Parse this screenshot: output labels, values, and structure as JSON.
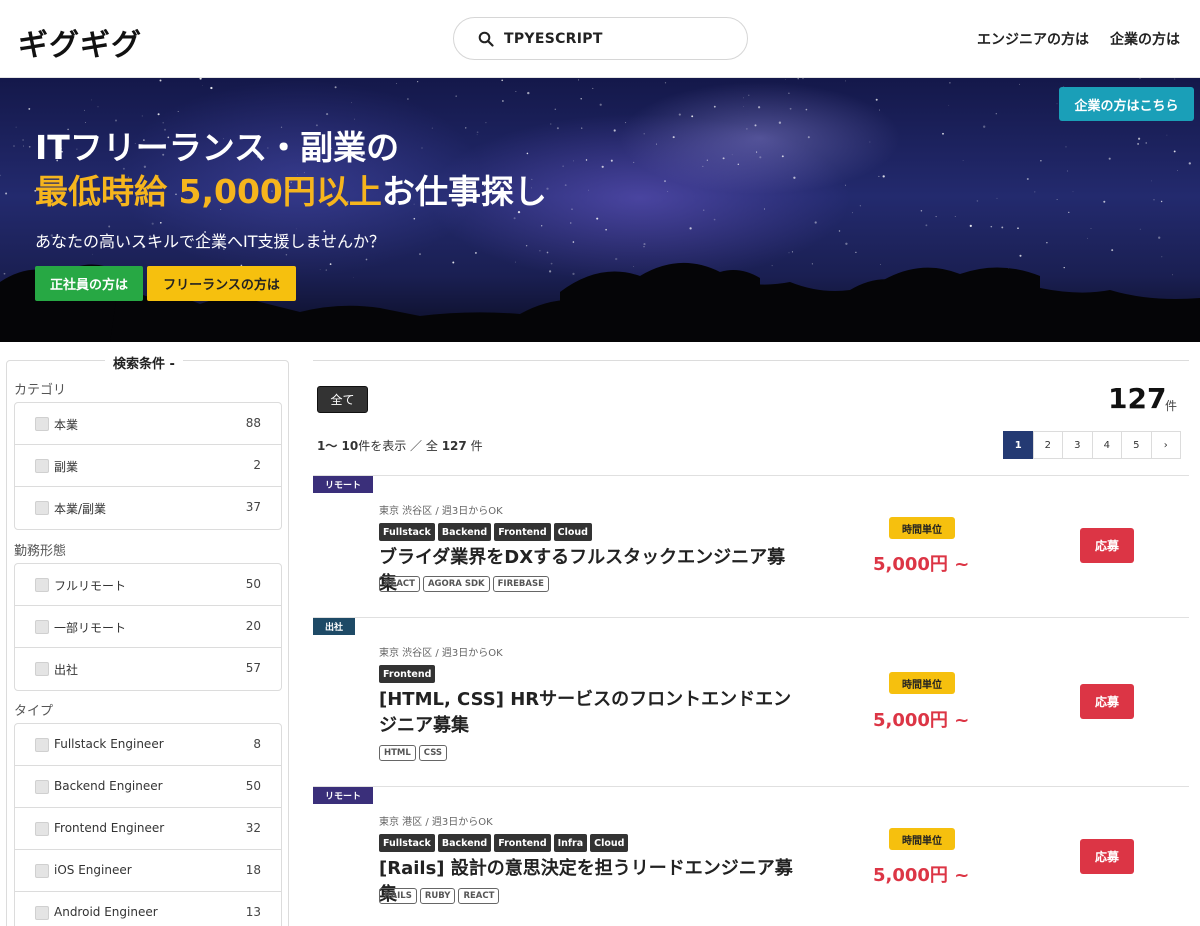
{
  "header": {
    "logo": "ギグギグ",
    "search_value": "TPYESCRIPT",
    "nav_engineer": "エンジニアの方は",
    "nav_company": "企業の方は"
  },
  "hero": {
    "corp_button": "企業の方はこちら",
    "line1": "ITフリーランス・副業の",
    "line2_accent": "最低時給 5,000円以上",
    "line2_rest": "お仕事探し",
    "subtitle": "あなたの高いスキルで企業へIT支援しませんか？",
    "btn_fulltime": "正社員の方は",
    "btn_freelance": "フリーランスの方は"
  },
  "sidebar": {
    "legend": "検索条件 -",
    "groups": [
      {
        "heading": "カテゴリ",
        "items": [
          {
            "label": "本業",
            "count": "88"
          },
          {
            "label": "副業",
            "count": "2"
          },
          {
            "label": "本業/副業",
            "count": "37"
          }
        ]
      },
      {
        "heading": "勤務形態",
        "items": [
          {
            "label": "フルリモート",
            "count": "50"
          },
          {
            "label": "一部リモート",
            "count": "20"
          },
          {
            "label": "出社",
            "count": "57"
          }
        ]
      },
      {
        "heading": "タイプ",
        "items": [
          {
            "label": "Fullstack Engineer",
            "count": "8"
          },
          {
            "label": "Backend Engineer",
            "count": "50"
          },
          {
            "label": "Frontend Engineer",
            "count": "32"
          },
          {
            "label": "iOS Engineer",
            "count": "18"
          },
          {
            "label": "Android Engineer",
            "count": "13"
          }
        ]
      }
    ]
  },
  "results": {
    "filter_all": "全て",
    "total_count": "127",
    "total_unit": "件",
    "range_prefix": "1〜 10",
    "range_middle": "件を表示 ／ 全 ",
    "range_total": "127",
    "range_suffix": " 件",
    "pages": [
      "1",
      "2",
      "3",
      "4",
      "5",
      "›"
    ],
    "active_page": "1"
  },
  "jobs": [
    {
      "work_style": "リモート",
      "location": "東京 渋谷区 / 週3日からOK",
      "types": [
        "Fullstack",
        "Backend",
        "Frontend",
        "Cloud"
      ],
      "title": "ブライダ業界をDXするフルスタックエンジニア募集",
      "skills": [
        "REACT",
        "AGORA SDK",
        "FIREBASE"
      ],
      "rate_type": "時間単位",
      "price": "5,000円 ~",
      "apply": "応募"
    },
    {
      "work_style": "出社",
      "location": "東京 渋谷区 / 週3日からOK",
      "types": [
        "Frontend"
      ],
      "title": "[HTML, CSS] HRサービスのフロントエンドエンジニア募集",
      "skills": [
        "HTML",
        "CSS"
      ],
      "rate_type": "時間単位",
      "price": "5,000円 ~",
      "apply": "応募"
    },
    {
      "work_style": "リモート",
      "location": "東京 港区 / 週3日からOK",
      "types": [
        "Fullstack",
        "Backend",
        "Frontend",
        "Infra",
        "Cloud"
      ],
      "title": "[Rails] 設計の意思決定を担うリードエンジニア募集",
      "skills": [
        "RAILS",
        "RUBY",
        "REACT"
      ],
      "rate_type": "時間単位",
      "price": "5,000円 ~",
      "apply": "応募"
    }
  ]
}
